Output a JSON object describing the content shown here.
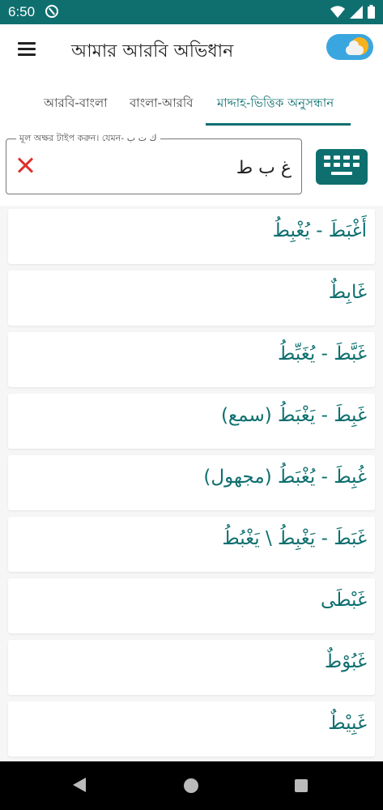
{
  "status_bar": {
    "time": "6:50",
    "icons": [
      "at-icon",
      "wifi-icon",
      "signal-icon",
      "battery-icon"
    ]
  },
  "app_bar": {
    "title": "আমার আরবি অভিধান",
    "menu_icon": "menu-icon",
    "theme_toggle_icon": "sun-cloud-icon"
  },
  "tabs": [
    {
      "label": "আরবি-বাংলা",
      "active": false
    },
    {
      "label": "বাংলা-আরবি",
      "active": false
    },
    {
      "label": "মাদ্দাহ-ভিত্তিক অনুসন্ধান",
      "active": true
    }
  ],
  "search": {
    "label": "মূল অক্ষর টাইপ করুন। যেমন- ك ت ب",
    "value": "غ ب ط",
    "clear_icon": "close-icon",
    "keyboard_icon": "keyboard-icon"
  },
  "results": [
    "أَغْبَطَ - يُغْبِطُ",
    "غَابِطٌ",
    "غَبَّطَ - يُغَبِّطُ",
    "غَبِطَ - يَغْبَطُ (سمع)",
    "غُبِطَ - يُغْبَطُ (مجهول)",
    "غَبَطَ - يَغْبِطُ \\ يَغْبُطُ",
    "غَبْطَى",
    "غَبُوْطٌ",
    "غَبِيْطٌ"
  ],
  "colors": {
    "primary": "#0f6f6f",
    "clear": "#e0302c",
    "toggle_bg": "#3aa6e0",
    "sun": "#f6b21a"
  }
}
